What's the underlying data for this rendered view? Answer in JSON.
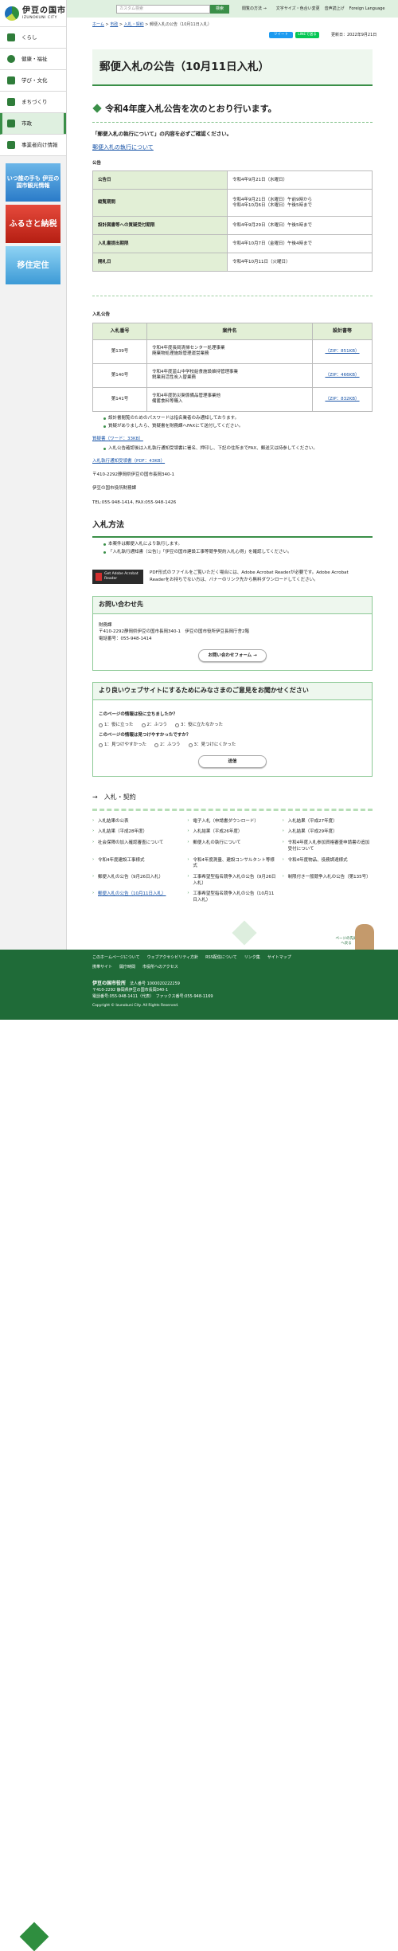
{
  "site": {
    "name_jp": "伊豆の国市",
    "name_en": "IZUNOKUNI CITY"
  },
  "topbar": {
    "search_placeholder": "カスタム検索",
    "search_btn": "検索",
    "links": [
      "閲覧の方法 →",
      "文字サイズ・色合い変更",
      "音声読上げ",
      "Foreign Language"
    ]
  },
  "sidebar": {
    "items": [
      "くらし",
      "健康・福祉",
      "学び・文化",
      "まちづくり",
      "市政",
      "事業者向け情報"
    ],
    "active": "市政",
    "banners": [
      "いつ誰の手も 伊豆の国市観光情報",
      "ふるさと納税",
      "移住定住"
    ]
  },
  "breadcrumb": [
    "ホーム",
    "市政",
    "入札・契約",
    "郵便入札の公告（10月11日入札）"
  ],
  "share": {
    "tweet": "ツイート",
    "line": "LINEで送る",
    "updated": "更新日：2022年9月21日"
  },
  "page": {
    "title": "郵便入札の公告（10月11日入札）",
    "heading": "令和4年度入札公告を次のとおり行います。",
    "intro": "「郵便入札の執行について」の内容を必ずご確認ください。",
    "intro_link": "郵便入札の執行について",
    "notice_label": "公告",
    "schedule": [
      {
        "label": "公告日",
        "value": "令和4年9月21日（水曜日）"
      },
      {
        "label": "縦覧期間",
        "value": "令和4年9月21日（水曜日）午前9時から\n令和4年10月6日（木曜日）午後5時まで"
      },
      {
        "label": "設計図書等への質疑受付期限",
        "value": "令和4年9月29日（木曜日）午後5時まで"
      },
      {
        "label": "入札書提出期限",
        "value": "令和4年10月7日（金曜日）午後4時まで"
      },
      {
        "label": "開札日",
        "value": "令和4年10月11日（火曜日）"
      }
    ],
    "bid_label": "入札公告",
    "bid_headers": [
      "入札番号",
      "案件名",
      "設計書等"
    ],
    "bids": [
      {
        "no": "第139号",
        "name": "令和4年度長岡清掃センター処理事業\n廃棄物処理施設管理運営業務",
        "file": "（ZIP：851KB）"
      },
      {
        "no": "第140号",
        "name": "令和4年度韮山中学校給食施設維持管理事業\n鋭業用活性炭入替業務",
        "file": "（ZIP：466KB）"
      },
      {
        "no": "第141号",
        "name": "令和4年度防災関係備品管理事業他\n備蓄食料等購入",
        "file": "（ZIP：832KB）"
      }
    ],
    "notes": [
      "設計書閲覧のためのパスワードは指名業者のみ通知しております。",
      "質疑がありましたら、質疑書を財務課へFAXにて送付してください。"
    ],
    "q_link": "質疑書（ワード：33KB）",
    "q_note": "入札公告確認後は入札執行通知受領書に署名、押印し、下記の住所までFAX、郵送又は持参してください。",
    "receipt_link": "入札執行通知受領書（PDF：43KB）",
    "address": [
      "〒410-2292静岡県伊豆の国市長岡340-1",
      "伊豆の国市役所財務課",
      "TEL:055-948-1414, FAX:055-948-1426"
    ],
    "method_title": "入札方法",
    "method": [
      "本案件は郵便入札により執行します。",
      "「入札執行通知書（公告）」「伊豆の国市建設工事等競争契約入札心得」を確認してください。"
    ],
    "pdf_badge": "Get Adobe Acrobat Reader",
    "pdf_text": "PDF形式のファイルをご覧いただく場合には、Adobe Acrobat Readerが必要です。Adobe Acrobat Readerをお持ちでない方は、バナーのリンク先から無料ダウンロードしてください。"
  },
  "contact": {
    "title": "お問い合わせ先",
    "lines": [
      "財務課",
      "〒410-2292静岡県伊豆の国市長岡340-1　伊豆の国市役所伊豆長岡庁舎2階",
      "電話番号：055-948-1414"
    ],
    "button": "お問い合わせフォーム →"
  },
  "survey": {
    "title": "より良いウェブサイトにするためにみなさまのご意見をお聞かせください",
    "q1": "このページの情報は役に立ちましたか？",
    "q1_opts": [
      "1：役に立った",
      "2：ふつう",
      "3：役に立たなかった"
    ],
    "q2": "このページの情報は見つけやすかったですか？",
    "q2_opts": [
      "1：見つけやすかった",
      "2：ふつう",
      "3：見つけにくかった"
    ],
    "button": "送信"
  },
  "footnav": {
    "title": "→　入札・契約",
    "items": [
      "入札結果の公表",
      "電子入札（申請書ダウンロード）",
      "入札結果（平成27年度）",
      "入札結果（平成28年度）",
      "入札結果（平成26年度）",
      "入札結果（平成29年度）",
      "社会保障の加入確認審査について",
      "郵便入札の執行について",
      "令和4年度入札参加資格審査申請書の追加受付について",
      "令和4年度建設工事様式",
      "令和4年度測量、建設コンサルタント等様式",
      "令和4年度物品、役務調達様式",
      "郵便入札の公告（9月26日入札）",
      "工事希望型指名競争入札の公告（9月26日入札）",
      "制限付き一般競争入札の公告（第135号）",
      "郵便入札の公告（10月11日入札）",
      "工事希望型指名競争入札の公告（10月11日入札）"
    ]
  },
  "pagetop": "ページの先頭へ戻る",
  "footer": {
    "links": [
      "このホームページについて",
      "ウェブアクセシビリティ方針",
      "RSS配信について",
      "リンク集",
      "サイトマップ",
      "携帯サイト",
      "開庁時間",
      "市役所へのアクセス"
    ],
    "org": "伊豆の国市役所",
    "corp": "法人番号 1000020222259",
    "addr": "〒410-2292 静岡県伊豆の国市長岡340-1",
    "tel": "電話番号:055-948-1411（代表）　ファックス番号:055-948-1169",
    "copy": "Copyright © Izunokuni City. All Rights Reserved."
  }
}
